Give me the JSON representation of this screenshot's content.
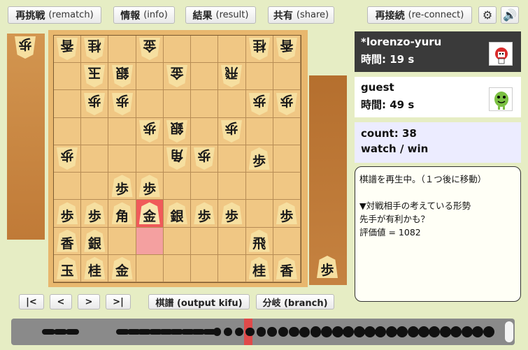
{
  "toolbar": {
    "rematch": {
      "jp": "再挑戦",
      "en": "(rematch)"
    },
    "info": {
      "jp": "情報",
      "en": "(info)"
    },
    "result": {
      "jp": "結果",
      "en": "(result)"
    },
    "share": {
      "jp": "共有",
      "en": "(share)"
    },
    "reconnect": {
      "jp": "再接続",
      "en": "(re-connect)"
    },
    "settings_icon": "gear-icon",
    "sound_icon": "speaker-icon"
  },
  "players": {
    "opponent": {
      "name": "*lorenzo-yuru",
      "time": "時間: 19 s"
    },
    "self": {
      "name": "guest",
      "time": "時間: 49 s"
    }
  },
  "stats": {
    "count": "count: 38",
    "watch": "watch / win"
  },
  "message": {
    "line1": "棋譜を再生中。（１つ後に移動）",
    "line2": "",
    "line3": "▼対戦相手の考えている形勢",
    "line4": "先手が有利かも？",
    "line5": "評価値 = 1082"
  },
  "nav": {
    "first": "|<",
    "prev": "<",
    "next": ">",
    "last": ">|",
    "kifu": "棋譜 (output kifu)",
    "branch": "分岐 (branch)"
  },
  "hands": {
    "gote": [
      "歩"
    ],
    "sente": [
      "歩"
    ]
  },
  "board": [
    [
      {
        "p": "香",
        "g": true
      },
      {
        "p": "桂",
        "g": true
      },
      {
        "p": ""
      },
      {
        "p": "金",
        "g": true
      },
      {
        "p": ""
      },
      {
        "p": ""
      },
      {
        "p": ""
      },
      {
        "p": "桂",
        "g": true
      },
      {
        "p": "香",
        "g": true
      }
    ],
    [
      {
        "p": ""
      },
      {
        "p": "玉",
        "g": true
      },
      {
        "p": "銀",
        "g": true
      },
      {
        "p": ""
      },
      {
        "p": "金",
        "g": true
      },
      {
        "p": ""
      },
      {
        "p": "飛",
        "g": true
      },
      {
        "p": ""
      },
      {
        "p": ""
      }
    ],
    [
      {
        "p": ""
      },
      {
        "p": "歩",
        "g": true
      },
      {
        "p": "歩",
        "g": true
      },
      {
        "p": ""
      },
      {
        "p": ""
      },
      {
        "p": ""
      },
      {
        "p": ""
      },
      {
        "p": "歩",
        "g": true
      },
      {
        "p": "歩",
        "g": true
      }
    ],
    [
      {
        "p": ""
      },
      {
        "p": ""
      },
      {
        "p": ""
      },
      {
        "p": "歩",
        "g": true
      },
      {
        "p": "銀",
        "g": true
      },
      {
        "p": ""
      },
      {
        "p": "歩",
        "g": true
      },
      {
        "p": ""
      },
      {
        "p": ""
      }
    ],
    [
      {
        "p": "歩",
        "g": true
      },
      {
        "p": ""
      },
      {
        "p": ""
      },
      {
        "p": ""
      },
      {
        "p": "角",
        "g": true
      },
      {
        "p": "歩",
        "g": true
      },
      {
        "p": ""
      },
      {
        "p": "歩"
      },
      {
        "p": ""
      }
    ],
    [
      {
        "p": ""
      },
      {
        "p": ""
      },
      {
        "p": "歩"
      },
      {
        "p": "歩"
      },
      {
        "p": ""
      },
      {
        "p": ""
      },
      {
        "p": ""
      },
      {
        "p": ""
      },
      {
        "p": ""
      }
    ],
    [
      {
        "p": "歩"
      },
      {
        "p": "歩"
      },
      {
        "p": "角"
      },
      {
        "p": "金",
        "hl": "last"
      },
      {
        "p": "銀"
      },
      {
        "p": "歩"
      },
      {
        "p": "歩"
      },
      {
        "p": ""
      },
      {
        "p": "歩"
      }
    ],
    [
      {
        "p": "香"
      },
      {
        "p": "銀"
      },
      {
        "p": ""
      },
      {
        "p": "",
        "hl": "from"
      },
      {
        "p": ""
      },
      {
        "p": ""
      },
      {
        "p": ""
      },
      {
        "p": "飛"
      },
      {
        "p": ""
      }
    ],
    [
      {
        "p": "玉"
      },
      {
        "p": "桂"
      },
      {
        "p": "金"
      },
      {
        "p": ""
      },
      {
        "p": ""
      },
      {
        "p": ""
      },
      {
        "p": ""
      },
      {
        "p": "桂"
      },
      {
        "p": "香"
      }
    ]
  ],
  "colors": {
    "last_move": "#f05a5a",
    "from_square": "#f4a0a0",
    "board": "#f0c784",
    "background": "#e6edc4"
  },
  "timeline": {
    "total_moves": 38,
    "current_move": 15
  }
}
